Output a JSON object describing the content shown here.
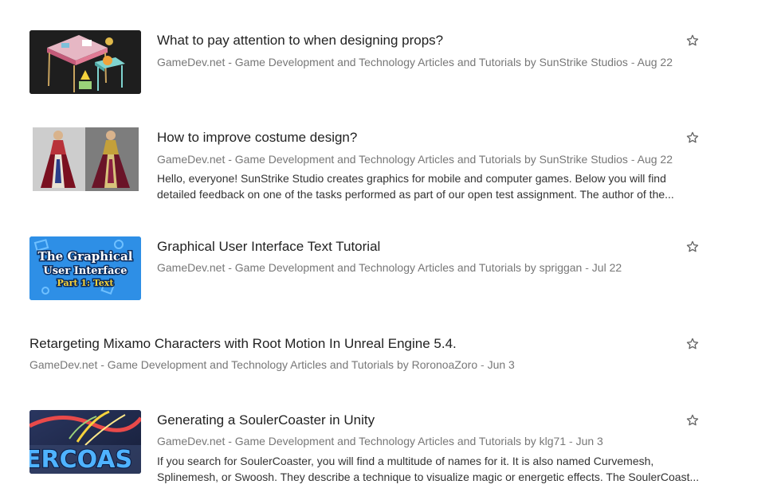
{
  "articles": [
    {
      "title": "What to pay attention to when designing props?",
      "source": "GameDev.net - Game Development and Technology Articles and Tutorials",
      "author_prefix": "by",
      "author": "SunStrike Studios",
      "date_sep": "-",
      "date": "Aug 22",
      "thumbnail": "props-desk-thumbnail"
    },
    {
      "title": "How to improve costume design?",
      "source": "GameDev.net - Game Development and Technology Articles and Tutorials",
      "author_prefix": "by",
      "author": "SunStrike Studios",
      "date_sep": "-",
      "date": "Aug 22",
      "snippet_line1": "Hello, everyone! SunStrike Studio creates graphics for mobile and computer games. Below you will find",
      "snippet_line2": "detailed feedback on one of the tasks performed as part of our open test assignment. The author of the...",
      "thumbnail": "costume-figures-thumbnail"
    },
    {
      "title": "Graphical User Interface Text Tutorial",
      "source": "GameDev.net - Game Development and Technology Articles and Tutorials",
      "author_prefix": "by",
      "author": "spriggan",
      "date_sep": "-",
      "date": "Jul 22",
      "thumb_line1": "The Graphical",
      "thumb_line2": "User Interface",
      "thumb_line3": "Part 1: Text",
      "thumbnail": "gui-text-thumbnail"
    },
    {
      "title": "Retargeting Mixamo Characters with Root Motion In Unreal Engine 5.4.",
      "source": "GameDev.net - Game Development and Technology Articles and Tutorials",
      "author_prefix": "by",
      "author": "RoronoaZoro",
      "date_sep": "-",
      "date": "Jun 3"
    },
    {
      "title": "Generating a SoulerCoaster in Unity",
      "source": "GameDev.net - Game Development and Technology Articles and Tutorials",
      "author_prefix": "by",
      "author": "klg71",
      "date_sep": "-",
      "date": "Jun 3",
      "snippet_line1": "If you search for SoulerCoaster, you will find a multitude of names for it. It is also named Curvemesh,",
      "snippet_line2": "Splinemesh, or Swoosh. They describe a technique to visualize magic or energetic effects. The SoulerCoast...",
      "thumb_text": "ERCOAS",
      "thumbnail": "soulercoaster-thumbnail"
    }
  ],
  "icons": {
    "favorite": "star-outline-icon"
  },
  "colors": {
    "title": "#222222",
    "meta": "#777777",
    "snippet": "#333333",
    "star": "#666666"
  }
}
